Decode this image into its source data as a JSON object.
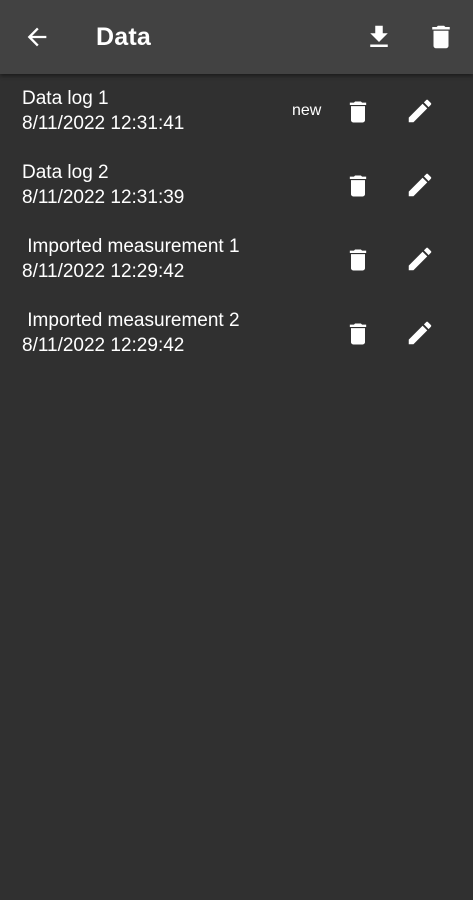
{
  "appbar": {
    "title": "Data",
    "back_icon": "arrow-back-icon",
    "download_icon": "download-icon",
    "delete_all_icon": "trash-icon"
  },
  "logs": [
    {
      "name": "Data log 1",
      "date": "8/11/2022 12:31:41",
      "badge": "new"
    },
    {
      "name": "Data log 2",
      "date": "8/11/2022 12:31:39",
      "badge": ""
    },
    {
      "name": " Imported measurement 1",
      "date": "8/11/2022 12:29:42",
      "badge": ""
    },
    {
      "name": " Imported measurement 2",
      "date": "8/11/2022 12:29:42",
      "badge": ""
    }
  ],
  "colors": {
    "background": "#303030",
    "appbar": "#424242",
    "foreground": "#ffffff"
  }
}
